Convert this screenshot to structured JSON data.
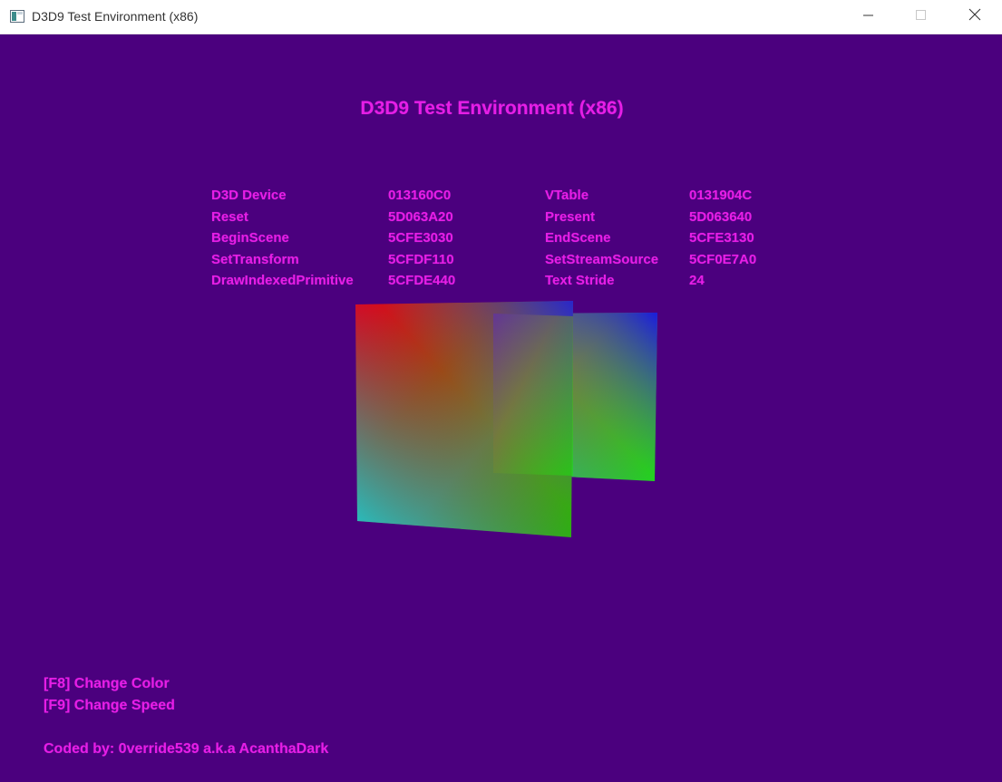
{
  "window": {
    "title": "D3D9 Test Environment (x86)",
    "icons": {
      "app": "window-app-icon",
      "minimize": "minimize-icon",
      "maximize": "maximize-icon",
      "close": "close-icon"
    }
  },
  "scene": {
    "title": "D3D9 Test Environment (x86)",
    "background_color": "#4b007e",
    "text_color": "#e61ee6",
    "info_rows": [
      {
        "label1": "D3D Device",
        "value1": "013160C0",
        "label2": "VTable",
        "value2": "0131904C"
      },
      {
        "label1": "Reset",
        "value1": "5D063A20",
        "label2": "Present",
        "value2": "5D063640"
      },
      {
        "label1": "BeginScene",
        "value1": "5CFE3030",
        "label2": "EndScene",
        "value2": "5CFE3130"
      },
      {
        "label1": "SetTransform",
        "value1": "5CFDF110",
        "label2": "SetStreamSource",
        "value2": "5CF0E7A0"
      },
      {
        "label1": "DrawIndexedPrimitive",
        "value1": "5CFDE440",
        "label2": "Text Stride",
        "value2": "24"
      }
    ],
    "hotkeys": {
      "f8": "[F8] Change Color",
      "f9": "[F9] Change Speed"
    },
    "credits": "Coded by: 0verride539 a.k.a AcanthaDark"
  }
}
